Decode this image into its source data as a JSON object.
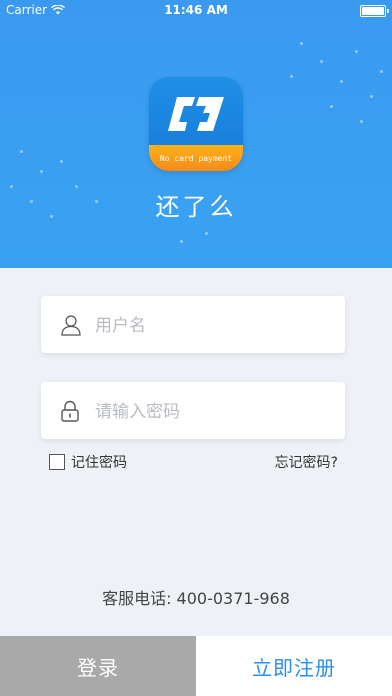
{
  "statusbar": {
    "carrier": "Carrier",
    "time": "11:46 AM"
  },
  "app": {
    "name": "还了么",
    "icon_band_text": "No card payment"
  },
  "form": {
    "username_placeholder": "用户名",
    "password_placeholder": "请输入密码",
    "remember_label": "记住密码",
    "forgot_label": "忘记密码?"
  },
  "hotline": "客服电话: 400-0371-968",
  "buttons": {
    "login": "登录",
    "register": "立即注册"
  },
  "colors": {
    "header": "#3a9af0",
    "login_button": "#a9a9a9",
    "register_text": "#2b8ee8"
  },
  "icons": {
    "wifi": "wifi-icon",
    "battery": "battery-icon",
    "user": "user-icon",
    "lock": "lock-icon"
  }
}
